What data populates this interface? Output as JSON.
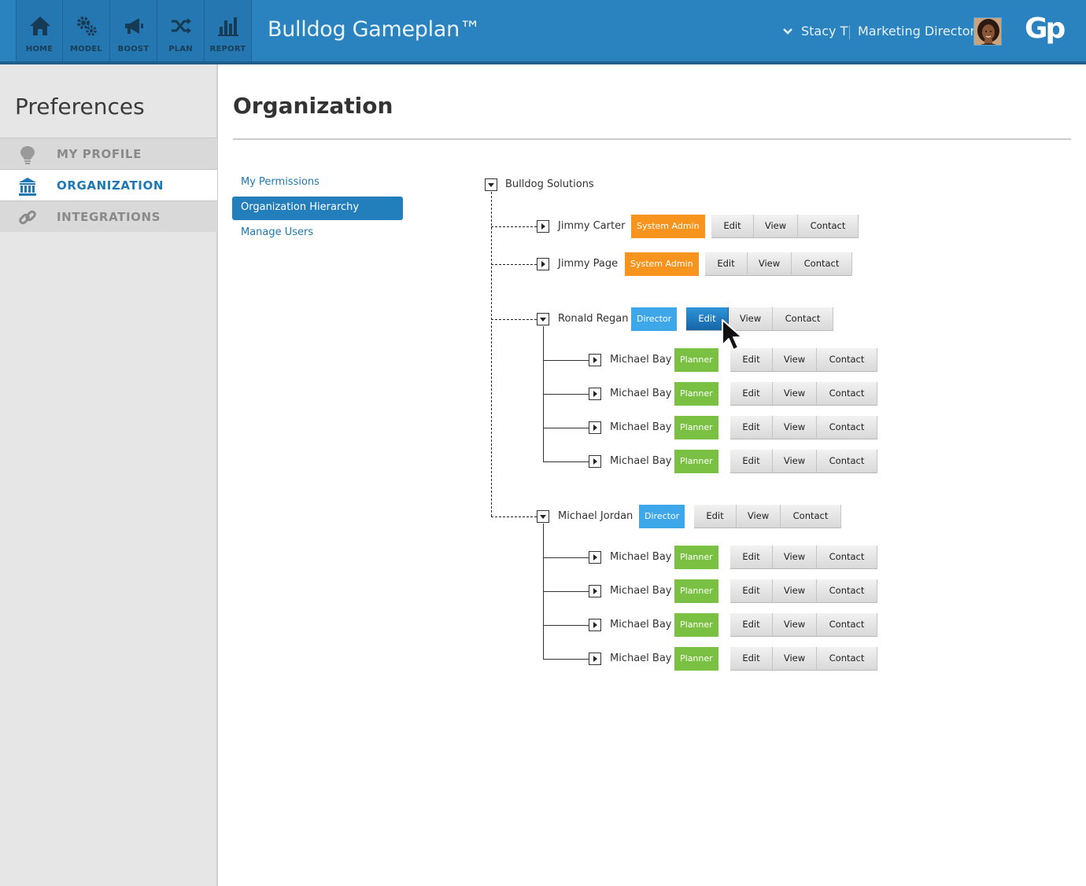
{
  "header": {
    "app_title": "Bulldog Gameplan™",
    "nav": [
      {
        "label": "HOME",
        "icon": "home-icon"
      },
      {
        "label": "MODEL",
        "icon": "gears-icon"
      },
      {
        "label": "BOOST",
        "icon": "megaphone-icon"
      },
      {
        "label": "PLAN",
        "icon": "shuffle-icon"
      },
      {
        "label": "REPORT",
        "icon": "bar-chart-icon"
      }
    ],
    "user_name": "Stacy T",
    "user_role": "Marketing Director",
    "logo_text": "Gp"
  },
  "sidebar": {
    "title": "Preferences",
    "items": [
      {
        "label": "MY PROFILE",
        "icon": "lightbulb-icon"
      },
      {
        "label": "ORGANIZATION",
        "icon": "bank-icon"
      },
      {
        "label": "INTEGRATIONS",
        "icon": "link-icon"
      }
    ]
  },
  "main": {
    "title": "Organization",
    "subnav": [
      "My Permissions",
      "Organization Hierarchy",
      "Manage Users"
    ]
  },
  "tree": {
    "root": "Bulldog Solutions",
    "buttons": {
      "edit": "Edit",
      "view": "View",
      "contact": "Contact"
    },
    "roles": {
      "admin": "System Admin",
      "director": "Director",
      "planner": "Planner"
    },
    "nodes": [
      {
        "name": "Jimmy Carter",
        "role": "System Admin"
      },
      {
        "name": "Jimmy Page",
        "role": "System Admin"
      },
      {
        "name": "Ronald Regan",
        "role": "Director"
      },
      {
        "name": "Michael Bay",
        "role": "Planner"
      },
      {
        "name": "Michael Bay",
        "role": "Planner"
      },
      {
        "name": "Michael Bay",
        "role": "Planner"
      },
      {
        "name": "Michael Bay",
        "role": "Planner"
      },
      {
        "name": "Michael Jordan",
        "role": "Director"
      },
      {
        "name": "Michael Bay",
        "role": "Planner"
      },
      {
        "name": "Michael Bay",
        "role": "Planner"
      },
      {
        "name": "Michael Bay",
        "role": "Planner"
      },
      {
        "name": "Michael Bay",
        "role": "Planner"
      }
    ]
  },
  "colors": {
    "header_blue": "#2a82bf",
    "admin_orange": "#f7941d",
    "director_blue": "#3ea7ea",
    "planner_green": "#7ac143",
    "active_blue": "#1e78b4"
  }
}
